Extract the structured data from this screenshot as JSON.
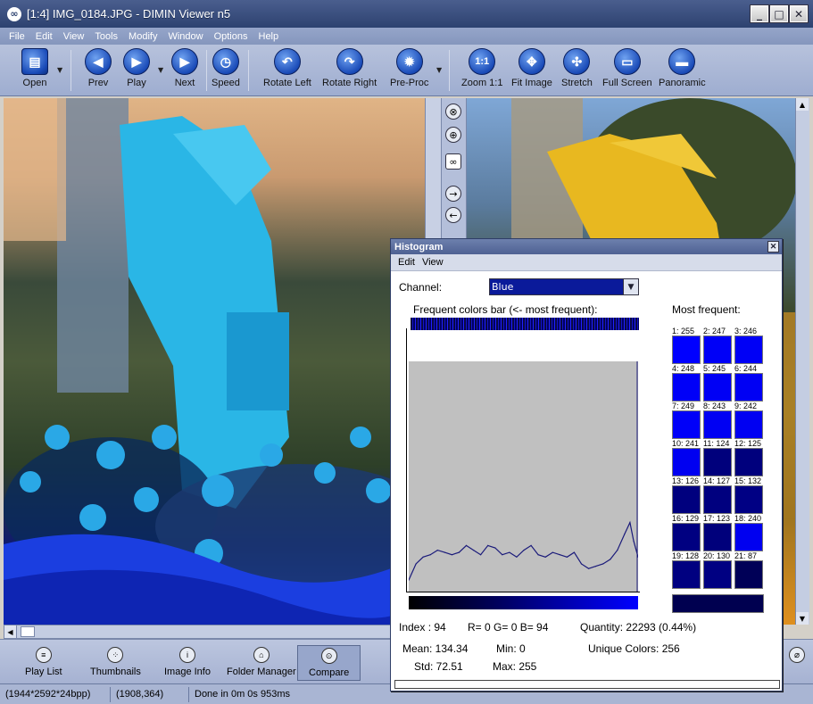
{
  "window": {
    "title": "[1:4] IMG_0184.JPG - DIMIN Viewer n5",
    "controls": [
      "_",
      "□",
      "✕"
    ]
  },
  "menubar": [
    "File",
    "Edit",
    "View",
    "Tools",
    "Modify",
    "Window",
    "Options",
    "Help"
  ],
  "toolbar": {
    "open": "Open",
    "prev": "Prev",
    "play": "Play",
    "next": "Next",
    "speed": "Speed",
    "rotate_left": "Rotate Left",
    "rotate_right": "Rotate Right",
    "preproc": "Pre-Proc",
    "zoom": "Zoom 1:1",
    "zoom_icon": "1:1",
    "fit": "Fit Image",
    "stretch": "Stretch",
    "fullscreen": "Full Screen",
    "panoramic": "Panoramic"
  },
  "bottombar": {
    "playlist": "Play List",
    "thumbnails": "Thumbnails",
    "imageinfo": "Image Info",
    "foldermanager": "Folder Manager",
    "compare": "Compare"
  },
  "statusbar": {
    "dims": "(1944*2592*24bpp)",
    "coords": "(1908,364)",
    "timing": "Done in 0m 0s 953ms"
  },
  "histogram": {
    "title": "Histogram",
    "menu": [
      "Edit",
      "View"
    ],
    "channel_label": "Channel:",
    "channel_value": "Blue",
    "freq_bar_label": "Frequent colors bar (<- most frequent):",
    "most_frequent_label": "Most frequent:",
    "most_frequent": [
      {
        "label": "1: 255",
        "color": "#0000ff"
      },
      {
        "label": "2: 247",
        "color": "#0000f7"
      },
      {
        "label": "3: 246",
        "color": "#0000f6"
      },
      {
        "label": "4: 248",
        "color": "#0000f8"
      },
      {
        "label": "5: 245",
        "color": "#0000f5"
      },
      {
        "label": "6: 244",
        "color": "#0000f4"
      },
      {
        "label": "7: 249",
        "color": "#0000f9"
      },
      {
        "label": "8: 243",
        "color": "#0000f3"
      },
      {
        "label": "9: 242",
        "color": "#0000f2"
      },
      {
        "label": "10: 241",
        "color": "#0000f1"
      },
      {
        "label": "11: 124",
        "color": "#00007c"
      },
      {
        "label": "12: 125",
        "color": "#00007d"
      },
      {
        "label": "13: 126",
        "color": "#00007e"
      },
      {
        "label": "14: 127",
        "color": "#00007f"
      },
      {
        "label": "15: 132",
        "color": "#000084"
      },
      {
        "label": "16: 129",
        "color": "#000081"
      },
      {
        "label": "17: 123",
        "color": "#00007b"
      },
      {
        "label": "18: 240",
        "color": "#0000f0"
      },
      {
        "label": "19: 128",
        "color": "#000080"
      },
      {
        "label": "20: 130",
        "color": "#000082"
      },
      {
        "label": "21: 87",
        "color": "#000057"
      }
    ],
    "index_text": "Index :  94",
    "rgb_text": "R=  0 G=  0 B= 94",
    "quantity_text": "Quantity: 22293 (0.44%)",
    "mean_text": "Mean: 134.34",
    "min_text": "Min: 0",
    "unique_text": "Unique Colors: 256",
    "std_text": "Std: 72.51",
    "max_text": "Max: 255"
  },
  "chart_data": {
    "type": "line",
    "x": [
      0,
      8,
      16,
      24,
      32,
      40,
      48,
      56,
      64,
      72,
      80,
      88,
      96,
      104,
      112,
      120,
      128,
      136,
      144,
      152,
      160,
      168,
      176,
      184,
      192,
      200,
      208,
      216,
      224,
      232,
      240,
      246,
      250,
      255
    ],
    "values": [
      0.05,
      0.12,
      0.15,
      0.16,
      0.18,
      0.17,
      0.16,
      0.17,
      0.2,
      0.18,
      0.16,
      0.2,
      0.19,
      0.16,
      0.17,
      0.15,
      0.18,
      0.2,
      0.16,
      0.15,
      0.17,
      0.16,
      0.15,
      0.17,
      0.12,
      0.1,
      0.11,
      0.12,
      0.14,
      0.18,
      0.25,
      0.3,
      0.22,
      0.15
    ],
    "xlim": [
      0,
      255
    ],
    "ylim": [
      0,
      1
    ],
    "color": "#1a1a7a"
  }
}
